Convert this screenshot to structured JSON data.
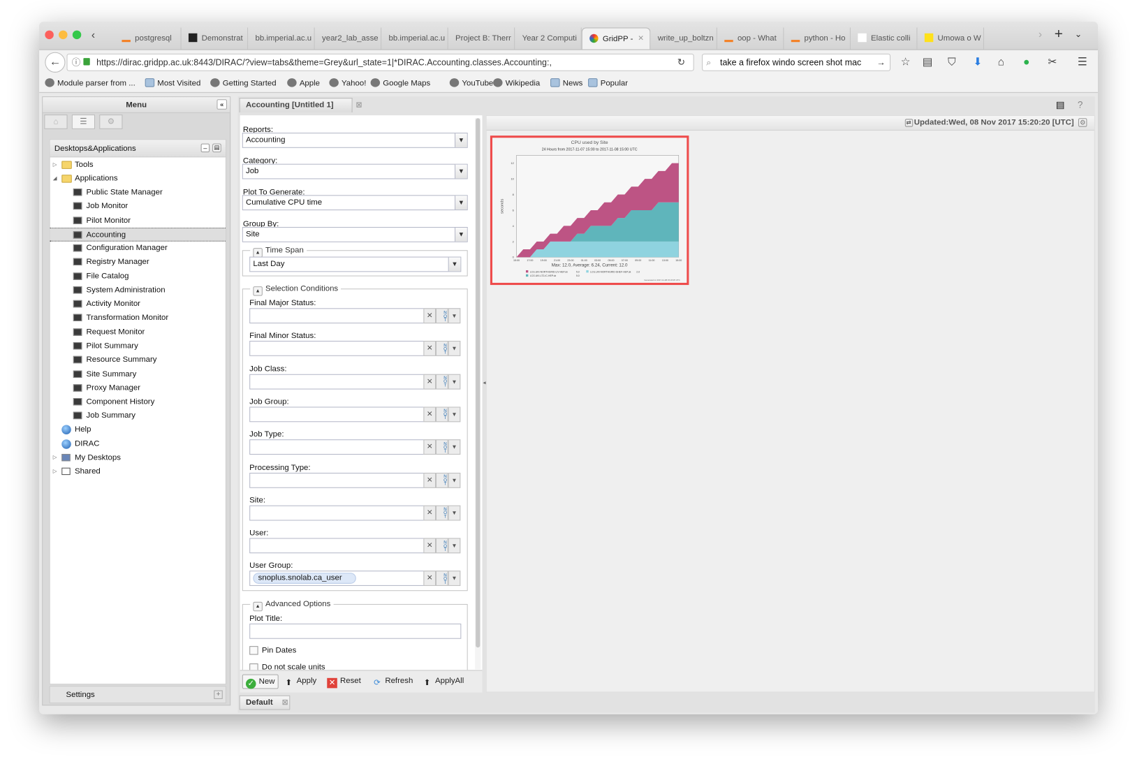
{
  "browser": {
    "tabs": [
      {
        "label": "postgresql",
        "icon": "stackoverflow-icon"
      },
      {
        "label": "Demonstrat",
        "icon": "blackboard-icon"
      },
      {
        "label": "bb.imperial.ac.u",
        "icon": ""
      },
      {
        "label": "year2_lab_asse",
        "icon": ""
      },
      {
        "label": "bb.imperial.ac.u",
        "icon": ""
      },
      {
        "label": "Project B: Therr",
        "icon": ""
      },
      {
        "label": "Year 2 Computi",
        "icon": ""
      },
      {
        "label": "GridPP -",
        "icon": "gridpp-icon",
        "active": true
      },
      {
        "label": "write_up_boltzn",
        "icon": ""
      },
      {
        "label": "oop - What",
        "icon": "stackoverflow-icon"
      },
      {
        "label": "python - Ho",
        "icon": "stackoverflow-icon"
      },
      {
        "label": "Elastic colli",
        "icon": "wikipedia-icon"
      },
      {
        "label": "Umowa o W",
        "icon": "f-icon"
      }
    ],
    "url": "https://dirac.gridpp.ac.uk:8443/DIRAC/?view=tabs&theme=Grey&url_state=1|*DIRAC.Accounting.classes.Accounting:,",
    "search_value": "take a firefox windo screen shot mac",
    "bookmarks": [
      "Module parser from ...",
      "Most Visited",
      "Getting Started",
      "Apple",
      "Yahoo!",
      "Google Maps",
      "YouTube",
      "Wikipedia",
      "News",
      "Popular"
    ]
  },
  "menu": {
    "title": "Menu",
    "tree_title": "Desktops&Applications",
    "tree": [
      {
        "label": "Tools",
        "type": "folder",
        "level": 0,
        "toggle": "▷"
      },
      {
        "label": "Applications",
        "type": "folder",
        "level": 0,
        "toggle": "◢"
      },
      {
        "label": "Public State Manager",
        "type": "app",
        "level": 1
      },
      {
        "label": "Job Monitor",
        "type": "app",
        "level": 1
      },
      {
        "label": "Pilot Monitor",
        "type": "app",
        "level": 1
      },
      {
        "label": "Accounting",
        "type": "app",
        "level": 1,
        "selected": true
      },
      {
        "label": "Configuration Manager",
        "type": "app",
        "level": 1
      },
      {
        "label": "Registry Manager",
        "type": "app",
        "level": 1
      },
      {
        "label": "File Catalog",
        "type": "app",
        "level": 1
      },
      {
        "label": "System Administration",
        "type": "app",
        "level": 1
      },
      {
        "label": "Activity Monitor",
        "type": "app",
        "level": 1
      },
      {
        "label": "Transformation Monitor",
        "type": "app",
        "level": 1
      },
      {
        "label": "Request Monitor",
        "type": "app",
        "level": 1
      },
      {
        "label": "Pilot Summary",
        "type": "app",
        "level": 1
      },
      {
        "label": "Resource Summary",
        "type": "app",
        "level": 1
      },
      {
        "label": "Site Summary",
        "type": "app",
        "level": 1
      },
      {
        "label": "Proxy Manager",
        "type": "app",
        "level": 1
      },
      {
        "label": "Component History",
        "type": "app",
        "level": 1
      },
      {
        "label": "Job Summary",
        "type": "app",
        "level": 1
      },
      {
        "label": "Help",
        "type": "globe",
        "level": 0
      },
      {
        "label": "DIRAC",
        "type": "globe",
        "level": 0
      },
      {
        "label": "My Desktops",
        "type": "desktop",
        "level": 0,
        "toggle": "▷"
      },
      {
        "label": "Shared",
        "type": "shared",
        "level": 0,
        "toggle": "▷"
      }
    ],
    "settings": "Settings"
  },
  "accounting": {
    "tab_title": "Accounting [Untitled 1]",
    "reports_label": "Reports:",
    "reports_value": "Accounting",
    "category_label": "Category:",
    "category_value": "Job",
    "plot_label": "Plot To Generate:",
    "plot_value": "Cumulative CPU time",
    "groupby_label": "Group By:",
    "groupby_value": "Site",
    "timespan_legend": "Time Span",
    "timespan_value": "Last Day",
    "selection_legend": "Selection Conditions",
    "conditions": [
      {
        "label": "Final Major Status:",
        "value": ""
      },
      {
        "label": "Final Minor Status:",
        "value": ""
      },
      {
        "label": "Job Class:",
        "value": ""
      },
      {
        "label": "Job Group:",
        "value": ""
      },
      {
        "label": "Job Type:",
        "value": ""
      },
      {
        "label": "Processing Type:",
        "value": ""
      },
      {
        "label": "Site:",
        "value": ""
      },
      {
        "label": "User:",
        "value": ""
      },
      {
        "label": "User Group:",
        "value": "snoplus.snolab.ca_user"
      }
    ],
    "not_label": "NOT",
    "advanced_legend": "Advanced Options",
    "plot_title_label": "Plot Title:",
    "plot_title_value": "",
    "pin_dates": "Pin Dates",
    "no_scale": "Do not scale units",
    "buttons": {
      "new": "New",
      "apply": "Apply",
      "reset": "Reset",
      "refresh": "Refresh",
      "applyall": "ApplyAll"
    },
    "updated": "Updated:Wed, 08 Nov 2017 15:20:20 [UTC]",
    "bottom_tab": "Default"
  },
  "chart_data": {
    "type": "area",
    "stacked": true,
    "title": "CPU used by Site",
    "subtitle": "24 Hours from 2017-11-07 15:00 to 2017-11-08 15:00 UTC",
    "ylabel": "seconds",
    "xlabel": "",
    "ylim": [
      0,
      13
    ],
    "yticks": [
      0,
      2,
      4,
      6,
      8,
      10,
      12
    ],
    "xtick_labels": [
      "15:00",
      "17:00",
      "19:00",
      "21:00",
      "23:00",
      "01:00",
      "03:00",
      "05:00",
      "07:00",
      "09:00",
      "11:00",
      "13:00",
      "15:00"
    ],
    "x_hours": 24,
    "series": [
      {
        "name": "LCG.UKI-NORTHGRID-SHEF-HEP.uk",
        "color": "#8fd3df",
        "legend_value": "2.0",
        "values": [
          0,
          0,
          0,
          1,
          1,
          2,
          2,
          2,
          2,
          2,
          2,
          2,
          2,
          2,
          2,
          2,
          2,
          2,
          2,
          2,
          2,
          2,
          2,
          2,
          2
        ]
      },
      {
        "name": "LCG.UKI-LT2-IC-HEP.uk",
        "color": "#5fb5bb",
        "legend_value": "5.0",
        "values": [
          0,
          0,
          0,
          0,
          0,
          0,
          0,
          0,
          0,
          1,
          1,
          2,
          2,
          2,
          2,
          3,
          3,
          4,
          4,
          4,
          4,
          5,
          5,
          5,
          5
        ]
      },
      {
        "name": "LCG.UKI-NORTHGRID-LIV-HEP.uk",
        "color": "#bd5484",
        "legend_value": "5.0",
        "values": [
          0,
          1,
          1,
          1,
          1,
          1,
          1,
          2,
          2,
          2,
          2,
          2,
          2,
          3,
          3,
          3,
          3,
          3,
          3,
          4,
          4,
          4,
          4,
          5,
          5
        ]
      }
    ],
    "summary": "Max: 12.0, Average: 6.24, Current: 12.0",
    "generated": "Generated on 2017-11-08 15:23:25 UTC",
    "legend_position": "bottom"
  }
}
